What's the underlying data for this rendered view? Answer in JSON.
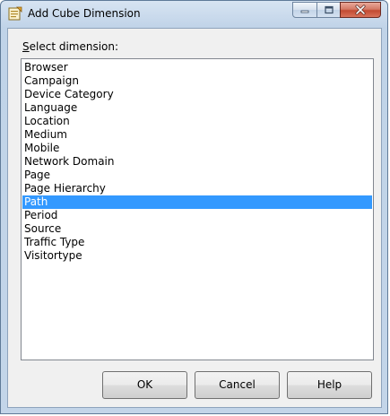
{
  "window": {
    "title": "Add Cube Dimension",
    "controls": {
      "minimize_icon": "minimize-icon",
      "maximize_icon": "maximize-icon",
      "close_icon": "close-icon"
    }
  },
  "dialog": {
    "label_prefix": "S",
    "label_rest": "elect dimension:",
    "items": [
      {
        "label": "Browser",
        "selected": false
      },
      {
        "label": "Campaign",
        "selected": false
      },
      {
        "label": "Device Category",
        "selected": false
      },
      {
        "label": "Language",
        "selected": false
      },
      {
        "label": "Location",
        "selected": false
      },
      {
        "label": "Medium",
        "selected": false
      },
      {
        "label": "Mobile",
        "selected": false
      },
      {
        "label": "Network Domain",
        "selected": false
      },
      {
        "label": "Page",
        "selected": false
      },
      {
        "label": "Page Hierarchy",
        "selected": false
      },
      {
        "label": "Path",
        "selected": true
      },
      {
        "label": "Period",
        "selected": false
      },
      {
        "label": "Source",
        "selected": false
      },
      {
        "label": "Traffic Type",
        "selected": false
      },
      {
        "label": "Visitortype",
        "selected": false
      }
    ]
  },
  "buttons": {
    "ok": "OK",
    "cancel": "Cancel",
    "help": "Help"
  },
  "colors": {
    "selection": "#3399ff",
    "client_bg": "#f0f0f0",
    "frame": "#c4d5e8"
  }
}
